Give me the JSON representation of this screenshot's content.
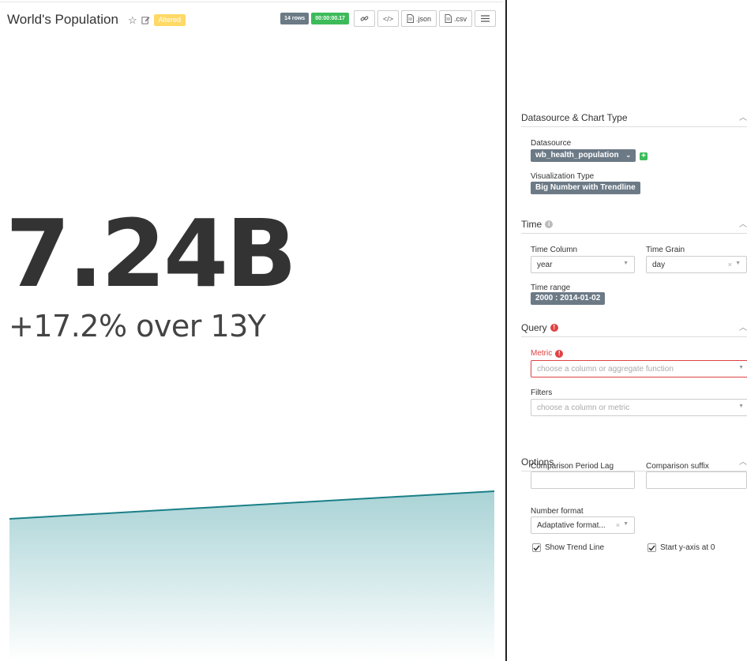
{
  "chart": {
    "title": "World's Population",
    "altered_label": "Altered",
    "rows_label": "14 rows",
    "query_time": "00:00:00.17",
    "json_label": ".json",
    "csv_label": ".csv",
    "big_number": "7.24B",
    "subheader": "+17.2% over 13Y",
    "trend_color": "#1a7f87",
    "trend_fill": "#a9d3d6"
  },
  "controls": {
    "datasource_section": "Datasource & Chart Type",
    "datasource_label": "Datasource",
    "datasource_value": "wb_health_population",
    "viz_type_label": "Visualization Type",
    "viz_type_value": "Big Number with Trendline",
    "time_section": "Time",
    "time_column_label": "Time Column",
    "time_column_value": "year",
    "time_grain_label": "Time Grain",
    "time_grain_value": "day",
    "time_range_label": "Time range",
    "time_range_value": "2000 : 2014-01-02",
    "query_section": "Query",
    "metric_label": "Metric",
    "metric_placeholder": "choose a column or aggregate function",
    "filters_label": "Filters",
    "filters_placeholder": "choose a column or metric",
    "options_section": "Options",
    "comparison_lag_label": "Comparison Period Lag",
    "comparison_suffix_label": "Comparison suffix",
    "number_format_label": "Number format",
    "number_format_value": "Adaptative format...",
    "show_trend_label": "Show Trend Line",
    "start_y_zero_label": "Start y-axis at 0"
  }
}
